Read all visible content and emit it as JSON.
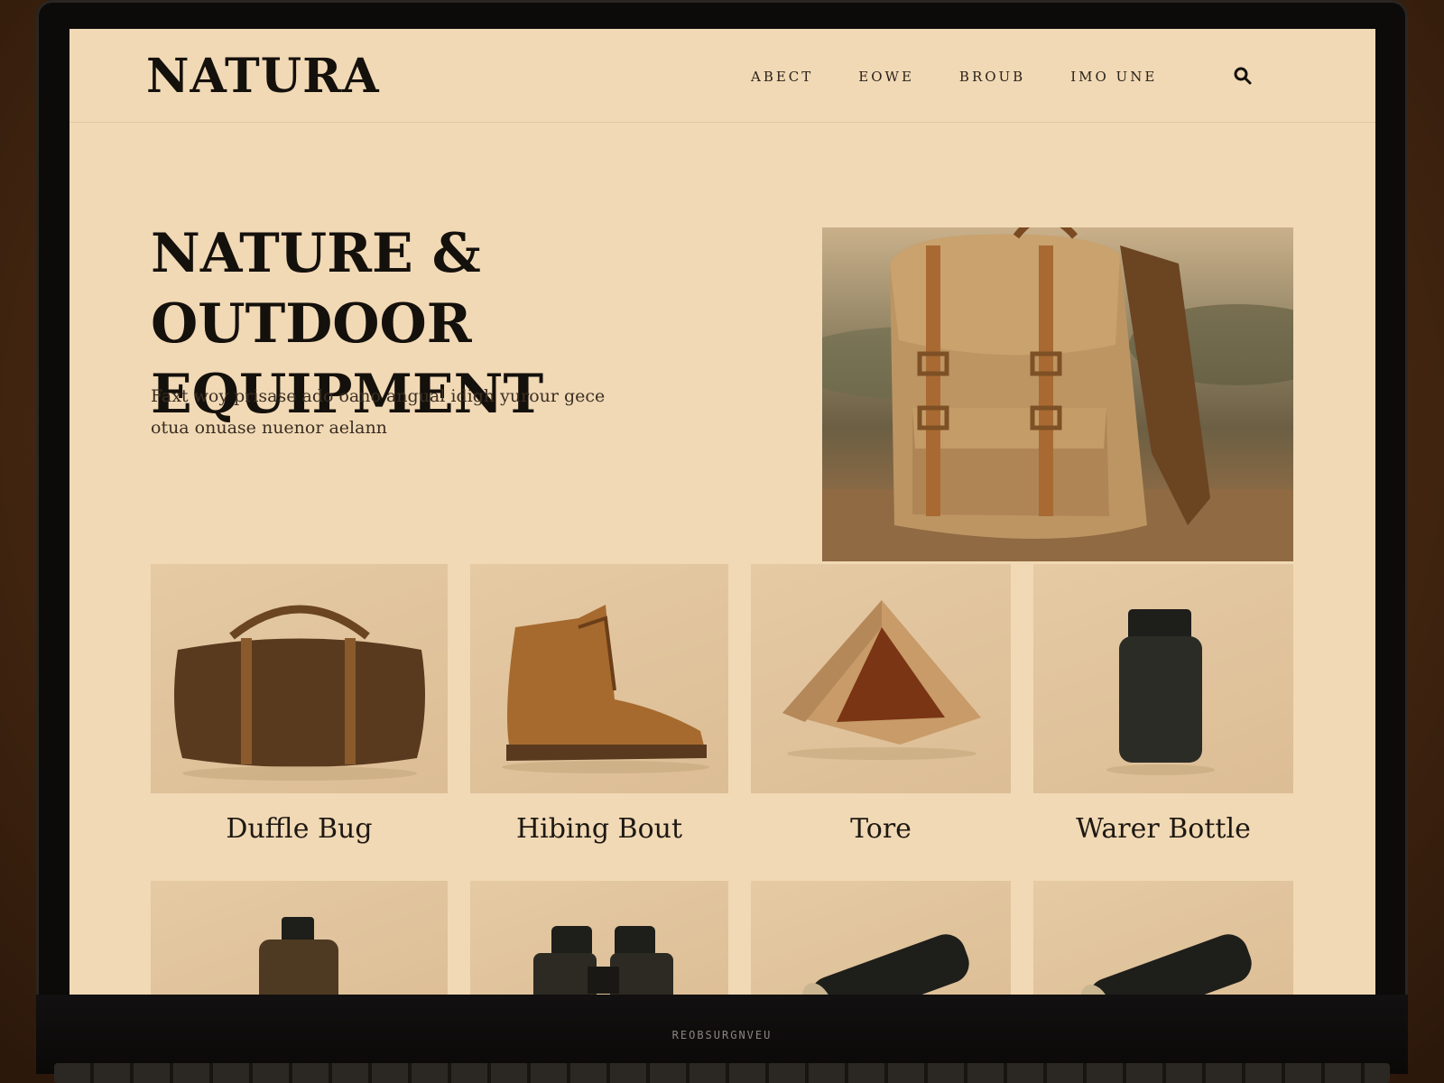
{
  "site": {
    "logo": "NATURA"
  },
  "nav": {
    "items": [
      {
        "label": "ABECT"
      },
      {
        "label": "EOWE"
      },
      {
        "label": "BROUB"
      },
      {
        "label": "IMO UNE"
      }
    ],
    "search_icon": "search-icon"
  },
  "hero": {
    "title": "NATURE & OUTDOOR\nEQUIPMENT",
    "text": "Faxt woy prisase ado oano angual idigh yurour gece otua onuase nuenor aelann",
    "image": "backpack-image"
  },
  "products": [
    {
      "label": "Duffle Bug",
      "image": "duffle-bag-image"
    },
    {
      "label": "Hibing Bout",
      "image": "hiking-boot-image"
    },
    {
      "label": "Tore",
      "image": "tent-image"
    },
    {
      "label": "Warer Bottle",
      "image": "water-bottle-image"
    }
  ],
  "products_row2": [
    {
      "image": "bottle-image"
    },
    {
      "image": "binoculars-image"
    },
    {
      "image": "flashlight-image"
    },
    {
      "image": "flashlight-image"
    }
  ],
  "device": {
    "chin_label": "REOBSURGNVEU"
  },
  "colors": {
    "page_bg": "#f1d9b5",
    "text": "#14100c",
    "card_bg": "#e0c39c"
  }
}
